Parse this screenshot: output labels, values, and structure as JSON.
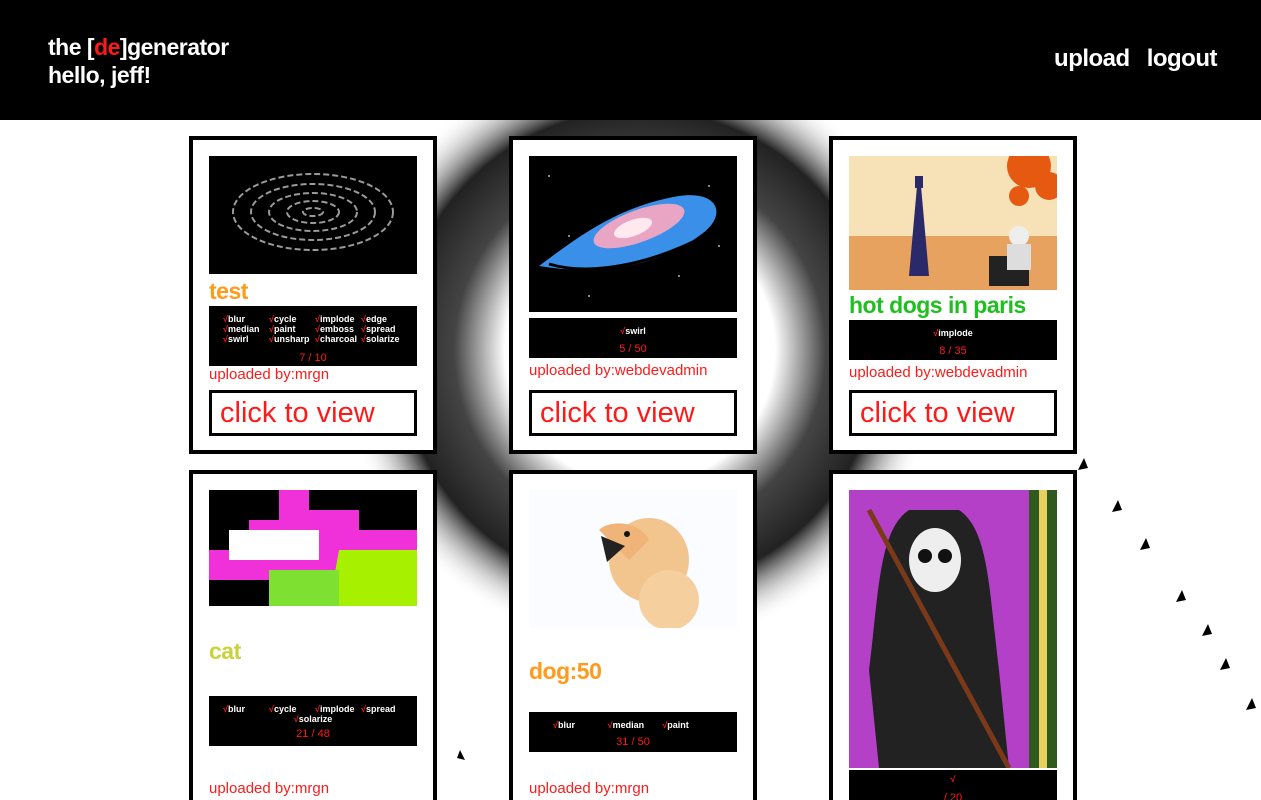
{
  "header": {
    "brand_prefix": "the [",
    "brand_highlight": "de",
    "brand_suffix": "]generator",
    "greeting": "hello, jeff!",
    "nav": {
      "upload": "upload",
      "logout": "logout"
    }
  },
  "cards": [
    {
      "title": "test",
      "title_color": "#ff9a1a",
      "effects": [
        "blur",
        "cycle",
        "implode",
        "edge",
        "median",
        "paint",
        "emboss",
        "spread",
        "swirl",
        "unsharp",
        "charcoal",
        "solarize"
      ],
      "count": "7 / 10",
      "uploader": "uploaded by:mrgn",
      "view": "click to view",
      "image": "swirl-fingerprint"
    },
    {
      "title": "",
      "effects": [
        "swirl"
      ],
      "count": "5 / 50",
      "uploader": "uploaded by:webdevadmin",
      "view": "click to view",
      "image": "galaxy"
    },
    {
      "title": "hot dogs in paris",
      "title_color": "#1fbf1f",
      "effects": [
        "implode"
      ],
      "count": "8 / 35",
      "uploader": "uploaded by:webdevadmin",
      "view": "click to view",
      "image": "paris-eiffel"
    },
    {
      "title": "cat",
      "title_color": "#c9d23a",
      "effects": [
        "blur",
        "cycle",
        "implode",
        "spread",
        "solarize"
      ],
      "count": "21 / 48",
      "uploader": "uploaded by:mrgn",
      "image": "neon-cat"
    },
    {
      "title": "dog:50",
      "title_color": "#ff9a1a",
      "effects": [
        "blur",
        "median",
        "paint"
      ],
      "count": "31 / 50",
      "uploader": "uploaded by:mrgn",
      "image": "dog"
    },
    {
      "title": "",
      "effects": [
        ""
      ],
      "count": "/ 20",
      "uploader": "",
      "image": "reaper-painting"
    }
  ],
  "check_glyph": "√"
}
